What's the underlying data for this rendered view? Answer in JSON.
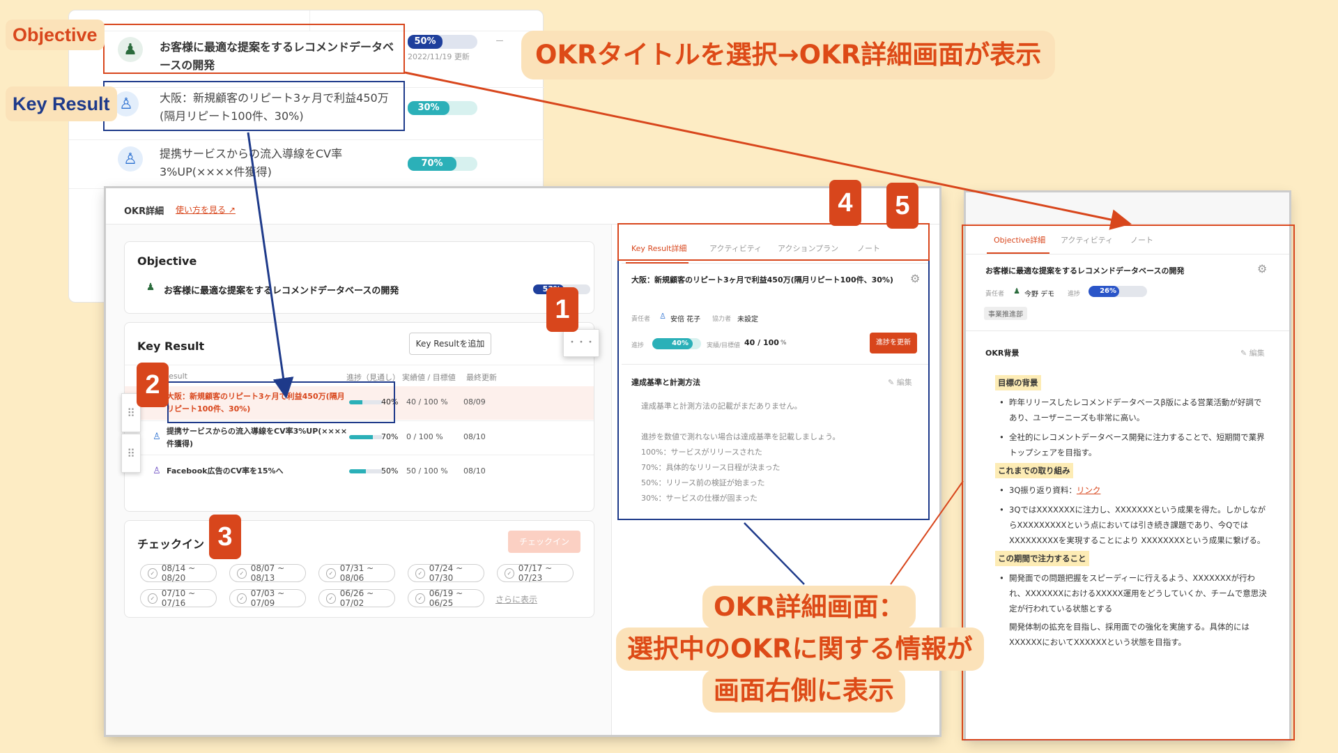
{
  "labels": {
    "objective": "Objective",
    "key_result": "Key Result"
  },
  "bg_list": {
    "row1": {
      "title": "お客様に最適な提案をするレコメンドデータベースの開発",
      "pct": "50%",
      "date": "2022/11/19 更新",
      "dash": "ー"
    },
    "row2": {
      "title": "大阪：新規顧客のリピート3ヶ月で利益450万(隔月リピート100件、30%)",
      "pct": "30%"
    },
    "row3": {
      "title": "提携サービスからの流入導線をCV率3%UP(××××件獲得)",
      "pct": "70%"
    }
  },
  "callouts": {
    "top": "OKRタイトルを選択→OKR詳細画面が表示",
    "bottom_line1": "OKR詳細画面：",
    "bottom_line2": "選択中のOKRに関する情報が",
    "bottom_line3": "画面右側に表示"
  },
  "badges": [
    "1",
    "2",
    "3",
    "4",
    "5"
  ],
  "detail": {
    "header_title": "OKR詳細",
    "help_link": "使い方を見る",
    "objective": {
      "heading": "Objective",
      "title": "お客様に最適な提案をするレコメンドデータベースの開発",
      "pct": "53%"
    },
    "key_result": {
      "heading": "Key Result",
      "add_button": "Key Resultを追加",
      "more_button": "・・・",
      "columns": [
        "Result",
        "進捗（見通し）",
        "実績値 / 目標値",
        "最終更新"
      ],
      "rows": [
        {
          "title": "大阪：新規顧客のリピート3ヶ月で利益450万(隔月リピート100件、30%)",
          "pct": "40%",
          "value": "40 / 100 %",
          "date": "08/09",
          "progress": 40
        },
        {
          "title": "提携サービスからの流入導線をCV率3%UP(××××件獲得)",
          "pct": "70%",
          "value": "0 / 100 %",
          "date": "08/10",
          "progress": 70
        },
        {
          "title": "Facebook広告のCV率を15%へ",
          "pct": "50%",
          "value": "50 / 100 %",
          "date": "08/10",
          "progress": 50
        }
      ]
    },
    "checkin": {
      "heading": "チェックイン",
      "button": "チェックイン",
      "chips": [
        "08/14 ~ 08/20",
        "08/07 ~ 08/13",
        "07/31 ~ 08/06",
        "07/24 ~ 07/30",
        "07/17 ~ 07/23",
        "07/10 ~ 07/16",
        "07/03 ~ 07/09",
        "06/26 ~ 07/02",
        "06/19 ~ 06/25"
      ],
      "more_link": "さらに表示"
    },
    "kr_panel": {
      "tabs": [
        "Key Result詳細",
        "アクティビティ",
        "アクションプラン",
        "ノート"
      ],
      "title": "大阪：新規顧客のリピート3ヶ月で利益450万(隔月リピート100件、30%)",
      "owner_label": "責任者",
      "owner": "安倍 花子",
      "collab_label": "協力者",
      "collab": "未設定",
      "progress_label": "進捗",
      "progress": "40%",
      "value_label": "実績/目標値",
      "value": "40 / 100",
      "value_unit": "%",
      "update_button": "進捗を更新",
      "criteria_heading": "達成基準と計測方法",
      "edit": "編集",
      "criteria_text": [
        "達成基準と計測方法の記載がまだありません。",
        "",
        "進捗を数値で測れない場合は達成基準を記載しましょう。",
        "100%：サービスがリリースされた",
        "70%：具体的なリリース日程が決まった",
        "50%：リリース前の検証が始まった",
        "30%：サービスの仕様が固まった"
      ]
    }
  },
  "obj_panel": {
    "tabs": [
      "Objective詳細",
      "アクティビティ",
      "ノート"
    ],
    "title": "お客様に最適な提案をするレコメンドデータベースの開発",
    "owner_label": "責任者",
    "owner": "今野 デモ",
    "progress_label": "進捗",
    "progress": "26%",
    "dept": "事業推進部",
    "bg_heading": "OKR背景",
    "edit": "編集",
    "sec1": "目標の背景",
    "b1": "昨年リリースしたレコメンドデータベースβ版による営業活動が好調であり、ユーザーニーズも非常に高い。",
    "b2": "全社的にレコメントデータベース開発に注力することで、短期間で業界トップシェアを目指す。",
    "sec2": "これまでの取り組み",
    "b3_prefix": "3Q振り返り資料：",
    "b3_link": "リンク",
    "b4": "3QではXXXXXXXに注力し、XXXXXXXという成果を得た。しかしながらXXXXXXXXXという点においては引き続き課題であり、今QではXXXXXXXXXを実現することにより XXXXXXXXという成果に繋げる。",
    "sec3": "この期間で注力すること",
    "b5": "開発面での問題把握をスピーディーに行えるよう、XXXXXXXが行われ、XXXXXXXにおけるXXXXX運用をどうしていくか、チームで意思決定が行われている状態とする",
    "b6": "開発体制の拡充を目指し、採用面での強化を実施する。具体的にはXXXXXXにおいてXXXXXXという状態を目指す。"
  },
  "colors": {
    "accent": "#d8461c",
    "navy": "#1e3a8a",
    "teal": "#2bb0b8",
    "blue": "#2a55c8"
  }
}
